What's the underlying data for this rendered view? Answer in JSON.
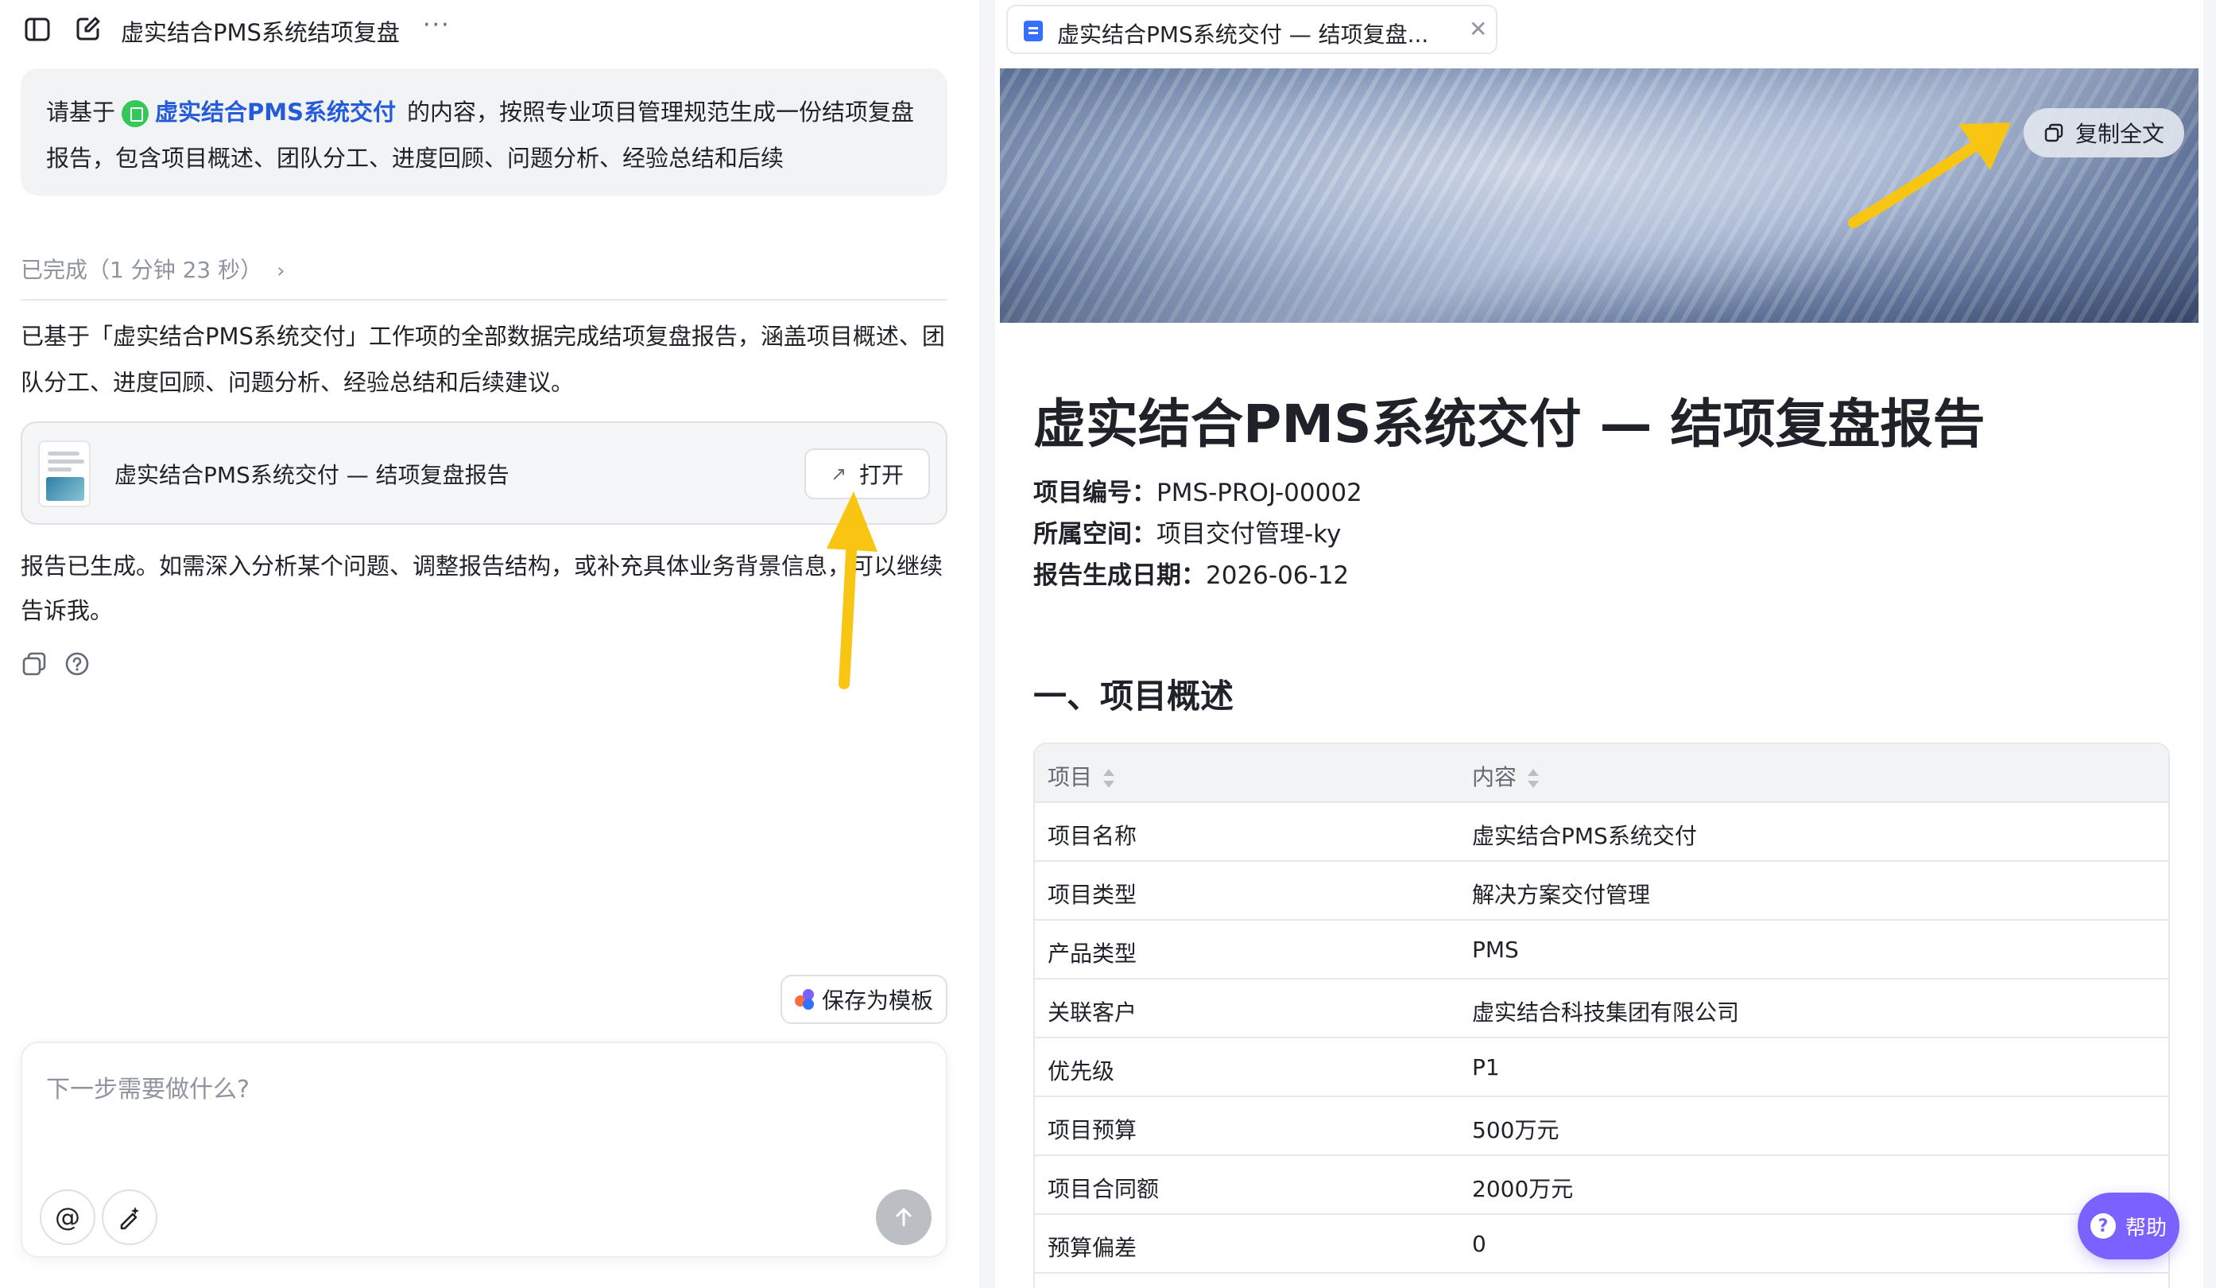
{
  "left": {
    "title": "虚实结合PMS系统结项复盘",
    "more": "···",
    "prompt": {
      "prefix": "请基于",
      "ref_name": "虚实结合PMS系统交付",
      "suffix": "的内容，按照专业项目管理规范生成一份结项复盘报告，包含项目概述、团队分工、进度回顾、问题分析、经验总结和后续"
    },
    "status": "已完成（1 分钟 23 秒）",
    "summary": "已基于「虚实结合PMS系统交付」工作项的全部数据完成结项复盘报告，涵盖项目概述、团队分工、进度回顾、问题分析、经验总结和后续建议。",
    "file_card": {
      "name": "虚实结合PMS系统交付 — 结项复盘报告",
      "open_label": "打开"
    },
    "followup": "报告已生成。如需深入分析某个问题、调整报告结构，或补充具体业务背景信息，可以继续告诉我。",
    "save_template": "保存为模板",
    "composer_placeholder": "下一步需要做什么?"
  },
  "right": {
    "tab_label": "虚实结合PMS系统交付 — 结项复盘...",
    "copy_all": "复制全文",
    "doc_title": "虚实结合PMS系统交付 — 结项复盘报告",
    "meta": [
      {
        "key": "项目编号：",
        "value": "PMS-PROJ-00002"
      },
      {
        "key": "所属空间：",
        "value": "项目交付管理-ky"
      },
      {
        "key": "报告生成日期：",
        "value": "2026-06-12"
      }
    ],
    "section1": "一、项目概述",
    "table": {
      "headers": [
        "项目",
        "内容"
      ],
      "rows": [
        [
          "项目名称",
          "虚实结合PMS系统交付"
        ],
        [
          "项目类型",
          "解决方案交付管理"
        ],
        [
          "产品类型",
          "PMS"
        ],
        [
          "关联客户",
          "虚实结合科技集团有限公司"
        ],
        [
          "优先级",
          "P1"
        ],
        [
          "项目预算",
          "500万元"
        ],
        [
          "项目合同额",
          "2000万元"
        ],
        [
          "预算偏差",
          "0"
        ]
      ]
    }
  },
  "help_label": "帮助",
  "colors": {
    "accent": "#245bdb",
    "help": "#7b61ff",
    "arrow": "#f9c513"
  }
}
